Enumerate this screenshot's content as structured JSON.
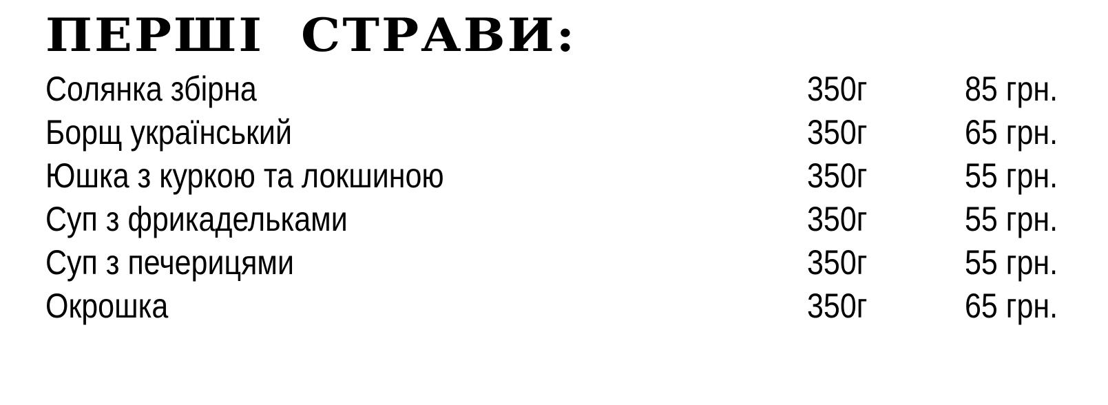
{
  "section": {
    "title": "ПЕРШІ  СТРАВИ:"
  },
  "items": [
    {
      "name": "Солянка збірна",
      "weight": "350г",
      "price": "85 грн."
    },
    {
      "name": "Борщ український",
      "weight": "350г",
      "price": "65 грн."
    },
    {
      "name": "Юшка з куркою та локшиною",
      "weight": "350г",
      "price": "55 грн."
    },
    {
      "name": "Суп з фрикадельками",
      "weight": "350г",
      "price": "55 грн."
    },
    {
      "name": "Суп з печерицями",
      "weight": "350г",
      "price": "55 грн."
    },
    {
      "name": "Окрошка",
      "weight": "350г",
      "price": "65 грн."
    }
  ]
}
